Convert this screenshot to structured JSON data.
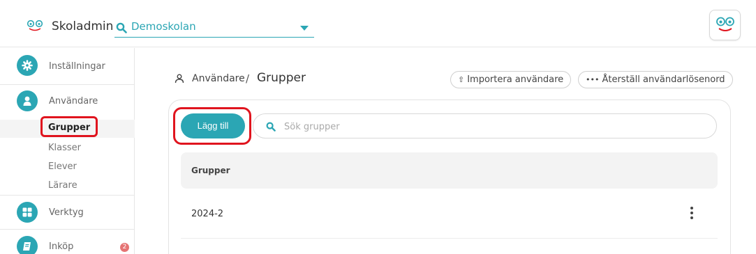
{
  "header": {
    "app_name": "Skoladmin",
    "school": "Demoskolan",
    "logo_icon": "smiley-eyes-icon",
    "accent": "#2ba6b4"
  },
  "sidebar": {
    "items": [
      {
        "label": "Inställningar",
        "icon": "gear-icon"
      },
      {
        "label": "Användare",
        "icon": "user-icon"
      },
      {
        "label": "Verktyg",
        "icon": "grid-icon"
      },
      {
        "label": "Inköp",
        "icon": "book-icon",
        "badge": "2"
      }
    ],
    "subitems": [
      "Grupper",
      "Klasser",
      "Elever",
      "Lärare"
    ],
    "active_subitem": "Grupper"
  },
  "breadcrumb": {
    "parent": "Användare",
    "separator": "/",
    "current": "Grupper"
  },
  "actions": {
    "import_label": "Importera användare",
    "reset_label": "Återställ användarlösenord"
  },
  "panel": {
    "add_label": "Lägg till",
    "search_placeholder": "Sök grupper",
    "search_value": "",
    "column_header": "Grupper",
    "rows": [
      {
        "name": "2024-2"
      }
    ]
  }
}
